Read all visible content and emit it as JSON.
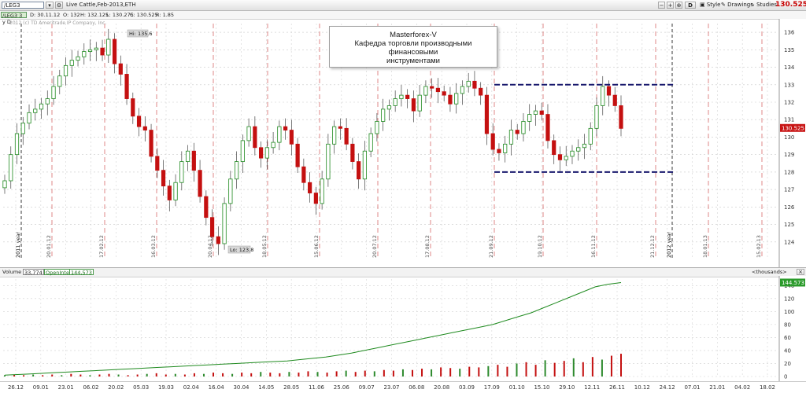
{
  "toolbar": {
    "symbol": "/LEG3",
    "instrument_title": "Live Cattle,Feb-2013,ETH",
    "d_button": "D",
    "style_label": "Style",
    "drawings_label": "Drawings",
    "studies_label": "Studies",
    "last_price": "130.525"
  },
  "header": {
    "chip": "/LEG3 3 y D",
    "date": "D: 30.11.12",
    "open": "O: 132",
    "high": "H: 132.125",
    "low": "L: 130.275",
    "close": "C: 130.525",
    "range": "R: 1.85",
    "copyright": "2012 (c) TD Ameritrade IP Company, Inc."
  },
  "annotation": {
    "line1": "Masterforex-V",
    "line2": "Кафедра торговли производными финансовыми",
    "line3": "инструментами"
  },
  "volume_panel": {
    "volume_label": "Volume",
    "volume_value": "33,774",
    "oi_label": "OpenInterest",
    "oi_value": "144,573",
    "units": "<thousands>",
    "oi_badge": "144.573"
  },
  "chart_data": {
    "type": "candlestick",
    "y_axis": {
      "min": 123,
      "max": 136.5,
      "ticks": [
        124,
        125,
        126,
        127,
        128,
        129,
        130,
        131,
        132,
        133,
        134,
        135,
        136
      ]
    },
    "last_price_label": "130.525",
    "high_label": "Hi: 135.6",
    "low_label": "Lo: 123.8",
    "channel": {
      "upper": 133.0,
      "lower": 128.0
    },
    "year_markers": [
      "2011 year",
      "2012 year"
    ],
    "vertical_dates": [
      "20.01.12",
      "17.02.12",
      "16.03.12",
      "20.04.12",
      "18.05.12",
      "15.06.12",
      "20.07.12",
      "17.08.12",
      "21.09.12",
      "19.10.12",
      "16.11.12",
      "21.12.12",
      "18.01.13",
      "15.02.13"
    ],
    "x_ticks": [
      "26.12",
      "09.01",
      "23.01",
      "06.02",
      "20.02",
      "05.03",
      "19.03",
      "02.04",
      "16.04",
      "30.04",
      "14.05",
      "28.05",
      "11.06",
      "25.06",
      "09.07",
      "23.07",
      "06.08",
      "20.08",
      "03.09",
      "17.09",
      "01.10",
      "15.10",
      "29.10",
      "12.11",
      "26.11",
      "10.12",
      "24.12",
      "07.01",
      "21.01",
      "04.02",
      "18.02"
    ],
    "closes": [
      127.5,
      129,
      130.2,
      130.8,
      131.4,
      131.6,
      131.9,
      132.2,
      132.9,
      133.5,
      134.1,
      134.4,
      134.6,
      134.9,
      135,
      135.1,
      134.7,
      135.6,
      134.2,
      133.6,
      132.2,
      131.2,
      130.6,
      130.4,
      128.9,
      128.1,
      127.2,
      126.4,
      127.4,
      128.6,
      129.2,
      128.1,
      126.6,
      125.4,
      124.3,
      123.9,
      126.2,
      127.6,
      128.6,
      129.8,
      130.6,
      129.4,
      128.8,
      129.4,
      129.7,
      130.6,
      130.4,
      129.6,
      128.3,
      127.4,
      126.8,
      126.2,
      127.6,
      129.6,
      130.6,
      130.5,
      129.6,
      128.6,
      127.6,
      129.2,
      130.2,
      130.9,
      131.6,
      131.8,
      132.2,
      132.4,
      132.2,
      131.5,
      132.4,
      132.9,
      132.8,
      132.6,
      132.4,
      131.9,
      132.5,
      132.9,
      133.2,
      132.8,
      132.4,
      130.2,
      129.3,
      129.1,
      129.6,
      130.4,
      130.2,
      130.9,
      131.3,
      131.5,
      131.3,
      129.8,
      129.0,
      128.7,
      128.9,
      129.2,
      129.4,
      129.6,
      130.5,
      131.8,
      132.9,
      132.4,
      131.8,
      130.5
    ],
    "open_interest": [
      2,
      3,
      4,
      5,
      6,
      7,
      8,
      9,
      10,
      11,
      12,
      13,
      14,
      15,
      16,
      17,
      18,
      19,
      20,
      21,
      22,
      23,
      24,
      26,
      28,
      30,
      33,
      36,
      40,
      44,
      48,
      52,
      56,
      60,
      64,
      68,
      72,
      76,
      80,
      86,
      92,
      98,
      106,
      114,
      122,
      130,
      138,
      142,
      144.573
    ],
    "volume_bars": [
      2,
      3,
      2,
      3,
      2,
      3,
      2,
      4,
      3,
      2,
      3,
      4,
      3,
      2,
      3,
      4,
      5,
      3,
      4,
      3,
      5,
      4,
      6,
      5,
      4,
      6,
      5,
      7,
      6,
      5,
      7,
      6,
      8,
      7,
      6,
      8,
      9,
      7,
      9,
      8,
      10,
      9,
      11,
      10,
      12,
      11,
      14,
      13,
      12,
      15,
      14,
      16,
      18,
      15,
      20,
      22,
      18,
      25,
      21,
      24,
      28,
      22,
      30,
      26,
      32,
      35
    ]
  }
}
